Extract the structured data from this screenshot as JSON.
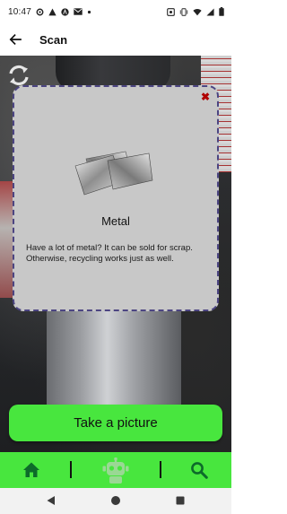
{
  "status_bar": {
    "time": "10:47",
    "left_icons": [
      "settings-gear-icon",
      "warning-icon",
      "autofill-a-icon",
      "gmail-icon",
      "dot-icon"
    ],
    "right_icons": [
      "nfc-icon",
      "vibrate-icon",
      "wifi-icon",
      "signal-icon",
      "battery-icon"
    ]
  },
  "app_bar": {
    "title": "Scan"
  },
  "modal": {
    "title": "Metal",
    "description": "Have a lot of metal? It can be sold for scrap. Otherwise, recycling works just as well.",
    "close_label": "✖"
  },
  "actions": {
    "take_picture_label": "Take a picture"
  },
  "bottom_nav": {
    "items": [
      "home-icon",
      "robot-icon",
      "search-icon"
    ]
  },
  "colors": {
    "accent_green": "#48e63e",
    "modal_bg": "#c8c8c8",
    "modal_border": "#4c4582",
    "close_red": "#b00000"
  }
}
